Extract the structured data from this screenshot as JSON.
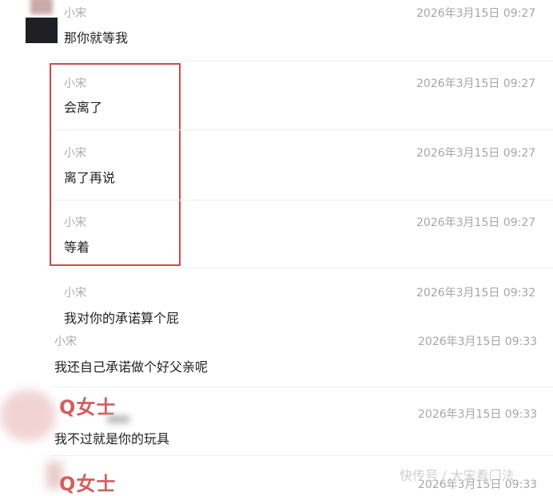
{
  "colors": {
    "highlight_box": "#cc4a4a",
    "sender_text": "#a9a9a9",
    "message_text": "#222222",
    "time_text": "#a6a6a6",
    "q_name": "#d06060"
  },
  "messages": [
    {
      "sender": "小宋",
      "time": "2026年3月15日 09:27",
      "text": "那你就等我"
    },
    {
      "sender": "小宋",
      "time": "2026年3月15日 09:27",
      "text": "会离了"
    },
    {
      "sender": "小宋",
      "time": "2026年3月15日 09:27",
      "text": "离了再说"
    },
    {
      "sender": "小宋",
      "time": "2026年3月15日 09:27",
      "text": "等着"
    },
    {
      "sender": "小宋",
      "time": "2026年3月15日 09:32",
      "text": "我对你的承诺算个屁"
    },
    {
      "sender": "小宋",
      "time": "2026年3月15日 09:33",
      "text": "我还自己承诺做个好父亲呢"
    },
    {
      "sender": "Q女士",
      "time": "2026年3月15日 09:33",
      "text": "我不过就是你的玩具"
    },
    {
      "sender": "Q女士",
      "time": "2026年3月15日 09:33",
      "text": ""
    }
  ],
  "watermark": "快传号 / 大宋看门法"
}
